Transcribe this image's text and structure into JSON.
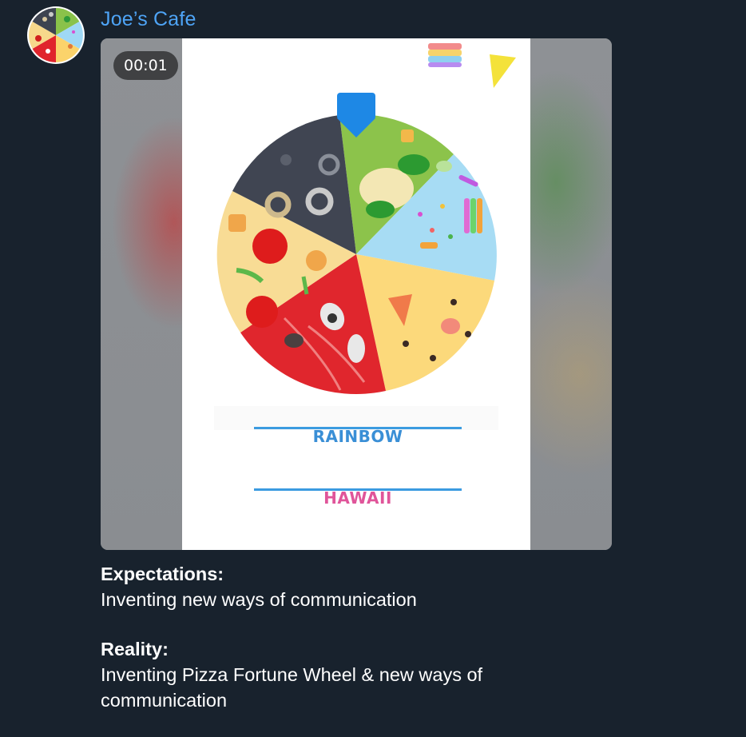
{
  "chat": {
    "sender_name": "Joe’s Cafe",
    "avatar_icon": "pizza-wheel-avatar"
  },
  "video": {
    "duration": "00:01",
    "wheel_icon": "pizza-fortune-wheel",
    "pointer_icon": "pointer-pin-icon",
    "options": [
      "RAINBOW",
      "HAWAII"
    ],
    "option_colors": [
      "#3a8fd6",
      "#e0559a"
    ],
    "line_color": "#3b9be0"
  },
  "caption": {
    "expectations_label": "Expectations:",
    "expectations_text": "Inventing new ways of communication",
    "reality_label": "Reality:",
    "reality_text_line1": "Inventing Pizza Fortune Wheel & new ways of",
    "reality_text_line2": "communication"
  },
  "colors": {
    "background": "#18222d",
    "sender": "#4ea4f6"
  }
}
